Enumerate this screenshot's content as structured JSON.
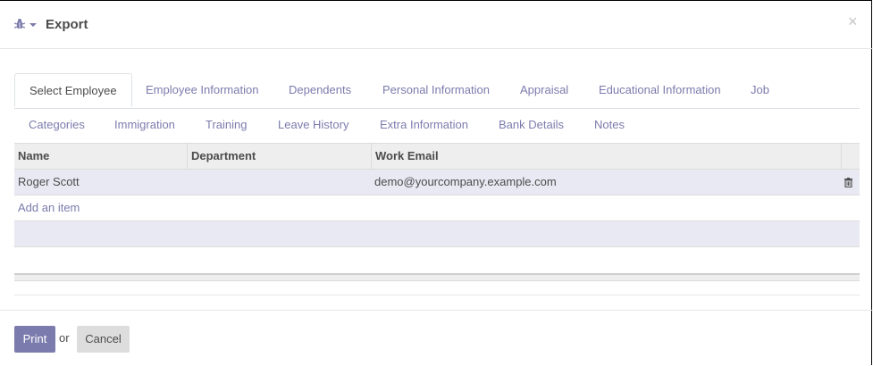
{
  "dialog": {
    "title": "Export",
    "close_glyph": "×"
  },
  "icons": {
    "debug": "bug-icon",
    "dropdown": "caret-down-icon",
    "close": "close-icon",
    "delete": "trash-icon"
  },
  "tabs": [
    {
      "label": "Select Employee",
      "active": true
    },
    {
      "label": "Employee Information"
    },
    {
      "label": "Dependents"
    },
    {
      "label": "Personal Information"
    },
    {
      "label": "Appraisal"
    },
    {
      "label": "Educational Information"
    },
    {
      "label": "Job"
    },
    {
      "label": "Categories"
    },
    {
      "label": "Immigration"
    },
    {
      "label": "Training"
    },
    {
      "label": "Leave History"
    },
    {
      "label": "Extra Information"
    },
    {
      "label": "Bank Details"
    },
    {
      "label": "Notes"
    }
  ],
  "table": {
    "columns": [
      "Name",
      "Department",
      "Work Email"
    ],
    "rows": [
      {
        "name": "Roger Scott",
        "department": "",
        "work_email": "demo@yourcompany.example.com"
      }
    ],
    "add_item_label": "Add an item"
  },
  "footer": {
    "print_label": "Print",
    "or_label": "or",
    "cancel_label": "Cancel"
  },
  "colors": {
    "accent": "#7c7bad",
    "row_highlight": "#e9e9f3",
    "header_bg": "#eeeeee",
    "cancel_bg": "#dddddd"
  }
}
